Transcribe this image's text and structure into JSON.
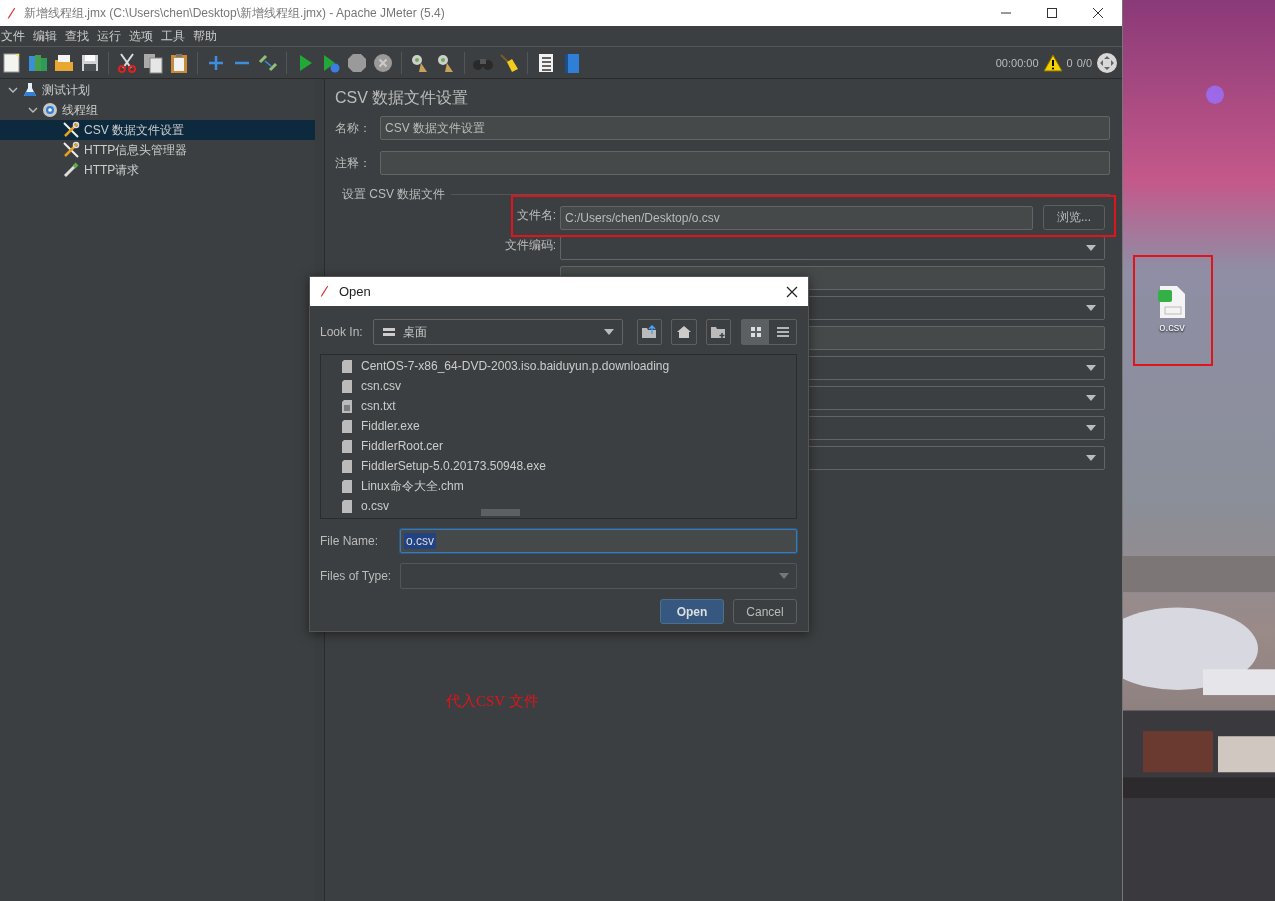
{
  "window": {
    "title": "新增线程组.jmx (C:\\Users\\chen\\Desktop\\新增线程组.jmx) - Apache JMeter (5.4)"
  },
  "menu": [
    "文件",
    "编辑",
    "查找",
    "运行",
    "选项",
    "工具",
    "帮助"
  ],
  "status": {
    "time": "00:00:00",
    "warnings": "0",
    "threads": "0/0"
  },
  "tree": [
    {
      "label": "测试计划",
      "kind": "plan",
      "expanded": true,
      "selected": false,
      "children": [
        {
          "label": "线程组",
          "kind": "threads",
          "expanded": true,
          "selected": false,
          "children": [
            {
              "label": "CSV 数据文件设置",
              "kind": "config",
              "selected": true
            },
            {
              "label": "HTTP信息头管理器",
              "kind": "config",
              "selected": false
            },
            {
              "label": "HTTP请求",
              "kind": "sampler",
              "selected": false
            }
          ]
        }
      ]
    }
  ],
  "panel": {
    "heading": "CSV 数据文件设置",
    "name_label": "名称：",
    "name_value": "CSV 数据文件设置",
    "comment_label": "注释：",
    "group_title": "设置 CSV 数据文件",
    "rows": [
      {
        "kind": "text",
        "label": "文件名:",
        "value": "C:/Users/chen/Desktop/o.csv",
        "button": "浏览..."
      },
      {
        "kind": "combo",
        "label": "文件编码:"
      },
      {
        "kind": "text"
      },
      {
        "kind": "combo"
      },
      {
        "kind": "text"
      },
      {
        "kind": "combo"
      },
      {
        "kind": "combo"
      },
      {
        "kind": "combo"
      },
      {
        "kind": "combo"
      }
    ]
  },
  "dialog": {
    "title": "Open",
    "look_in_label": "Look In:",
    "look_in_value": "桌面",
    "view_buttons": [
      {
        "kind": "grid",
        "selected": true
      },
      {
        "kind": "list",
        "selected": false
      }
    ],
    "files": [
      {
        "name": "CentOS-7-x86_64-DVD-2003.iso.baiduyun.p.downloading",
        "kind": "file"
      },
      {
        "name": "csn.csv",
        "kind": "file"
      },
      {
        "name": "csn.txt",
        "kind": "text"
      },
      {
        "name": "Fiddler.exe",
        "kind": "file"
      },
      {
        "name": "FiddlerRoot.cer",
        "kind": "file"
      },
      {
        "name": "FiddlerSetup-5.0.20173.50948.exe",
        "kind": "file"
      },
      {
        "name": "Linux命令大全.chm",
        "kind": "file"
      },
      {
        "name": "o.csv",
        "kind": "file"
      }
    ],
    "file_name_label": "File Name:",
    "file_name_value": "o.csv",
    "file_type_label": "Files of Type:",
    "buttons": [
      {
        "label": "Open",
        "kind": "default"
      },
      {
        "label": "Cancel",
        "kind": "plain"
      }
    ]
  },
  "desktop": {
    "icon_label": "o.csv"
  },
  "annotation": "代入CSV 文件"
}
